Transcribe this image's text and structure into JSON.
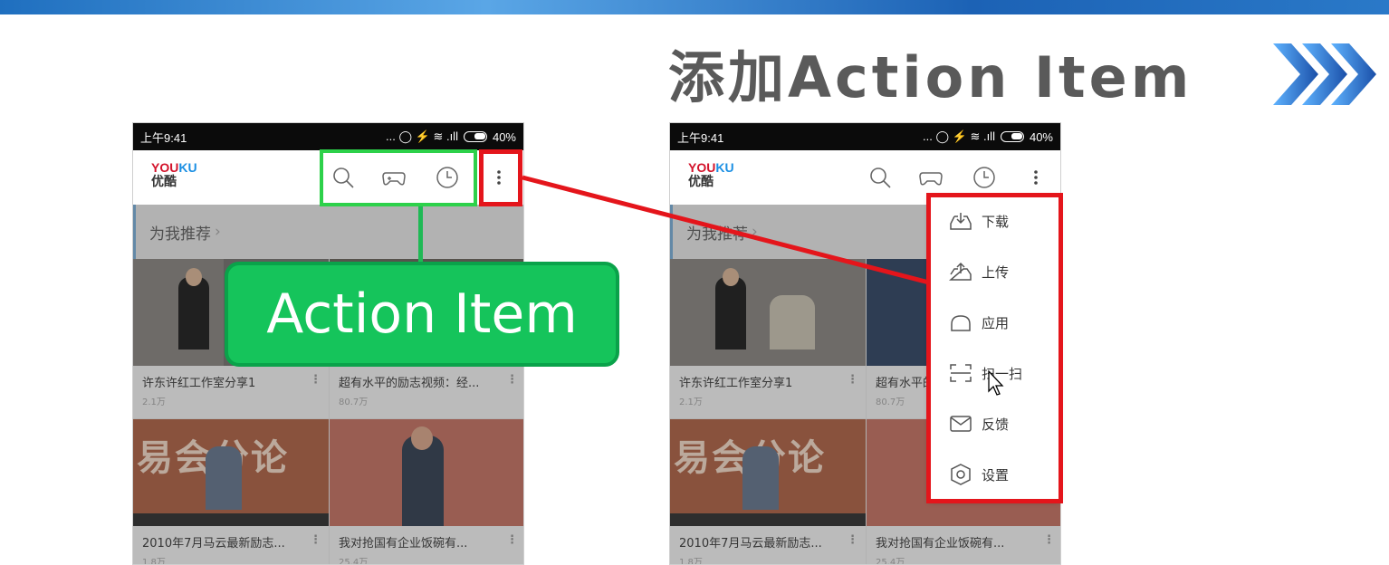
{
  "slide": {
    "title": "添加Action Item"
  },
  "status": {
    "time": "上午9:41",
    "battery": "40%",
    "icons": "... ◯ ⚡ ≋ .ıll"
  },
  "app": {
    "logo_en_you": "YOU",
    "logo_en_ku": "KU",
    "logo_cn": "优酷"
  },
  "toolbar": {
    "icons": [
      "search-icon",
      "gamepad-icon",
      "history-icon",
      "overflow-menu-icon"
    ]
  },
  "section": {
    "title": "为我推荐",
    "arrow": "›"
  },
  "videos": [
    {
      "title": "许东许红工作室分享1",
      "views": "2.1万"
    },
    {
      "title": "超有水平的励志视频：经...",
      "views": "80.7万"
    },
    {
      "title": "2010年7月马云最新励志...",
      "views": "1.8万"
    },
    {
      "title": "我对抢国有企业饭碗有...",
      "views": "25.4万"
    }
  ],
  "thumb_text": "易会分论",
  "callout": {
    "label": "Action Item"
  },
  "menu": {
    "items": [
      {
        "label": "下载",
        "icon": "download-icon"
      },
      {
        "label": "上传",
        "icon": "upload-icon"
      },
      {
        "label": "应用",
        "icon": "bag-icon"
      },
      {
        "label": "扫一扫",
        "icon": "scan-icon"
      },
      {
        "label": "反馈",
        "icon": "mail-icon"
      },
      {
        "label": "设置",
        "icon": "settings-icon"
      }
    ]
  },
  "colors": {
    "highlight_red": "#e4151b",
    "highlight_green": "#2dd14a",
    "callout_green": "#15c45b"
  }
}
